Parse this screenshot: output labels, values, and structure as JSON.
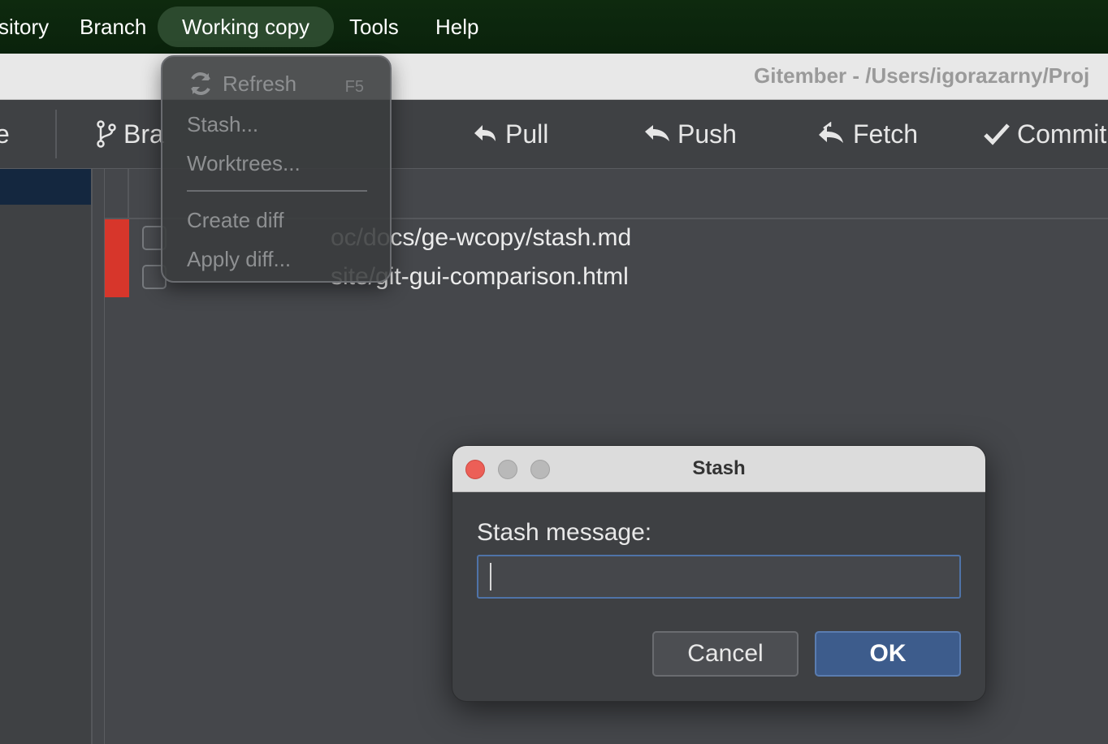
{
  "menubar": {
    "items": [
      {
        "label": "sitory"
      },
      {
        "label": "Branch"
      },
      {
        "label": "Working copy"
      },
      {
        "label": "Tools"
      },
      {
        "label": "Help"
      }
    ]
  },
  "window": {
    "title": "Gitember - /Users/igorazarny/Proj"
  },
  "toolbar": {
    "partial_left": "e",
    "branch": "Bra",
    "pull": "Pull",
    "push": "Push",
    "fetch": "Fetch",
    "commit": "Commit"
  },
  "files": [
    {
      "status": "",
      "path": "oc/docs/ge-wcopy/stash.md"
    },
    {
      "status": "",
      "path": "site/git-gui-comparison.html"
    }
  ],
  "dropdown": {
    "items": [
      {
        "label": "Refresh",
        "shortcut": "F5"
      },
      {
        "label": "Stash..."
      },
      {
        "label": "Worktrees..."
      },
      {
        "label": "Create diff"
      },
      {
        "label": "Apply diff..."
      }
    ]
  },
  "dialog": {
    "title": "Stash",
    "label": "Stash message:",
    "input_value": "",
    "cancel": "Cancel",
    "ok": "OK"
  },
  "colors": {
    "menubar": "#0e2a0e",
    "accent": "#3d5c8c",
    "status_bar": "#d7362b"
  }
}
